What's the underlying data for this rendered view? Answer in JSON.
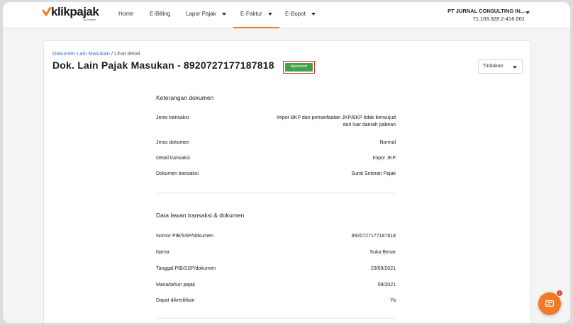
{
  "brand": {
    "name": "klikpajak",
    "tagline": "by mekari",
    "accent_color": "#f07a26"
  },
  "nav": {
    "items": [
      {
        "label": "Home",
        "dropdown": false,
        "active": false
      },
      {
        "label": "E-Billing",
        "dropdown": false,
        "active": false
      },
      {
        "label": "Lapor Pajak",
        "dropdown": true,
        "active": false
      },
      {
        "label": "E-Faktur",
        "dropdown": true,
        "active": true
      },
      {
        "label": "E-Bupot",
        "dropdown": true,
        "active": false
      }
    ]
  },
  "company": {
    "name": "PT JURNAL CONSULTING IN...",
    "npwp": "71.103.328.2-416.001"
  },
  "breadcrumb": {
    "parent": "Dokumen Lain Masukan",
    "separator": " / ",
    "current": "Lihat detail"
  },
  "page": {
    "title": "Dok. Lain Pajak Masukan - 8920727177187818",
    "status": "Approved",
    "status_color": "#3fa34d",
    "actions_label": "Tindakan"
  },
  "sections": {
    "doc_info": {
      "title": "Keterangan dokumen",
      "rows": [
        {
          "label": "Jenis transaksi",
          "value": "Impor BKP dan pemanfaatan JKP/BKP tidak berwujud dari luar daerah pabean"
        },
        {
          "label": "Jenis dokumen",
          "value": "Normal"
        },
        {
          "label": "Detail transaksi",
          "value": "Impor JKP"
        },
        {
          "label": "Dokumen transaksi",
          "value": "Surat Setoran Pajak"
        }
      ]
    },
    "counterparty": {
      "title": "Data lawan transaksi & dokumen",
      "rows": [
        {
          "label": "Nomor PIB/SSP/dokumen",
          "value": "8920727177187818"
        },
        {
          "label": "Nama",
          "value": "Suka Benar"
        },
        {
          "label": "Tanggal PIB/SSP/dokumen",
          "value": "23/09/2021"
        },
        {
          "label": "Masa/tahun pajak",
          "value": "09/2021"
        },
        {
          "label": "Dapat dikreditkan",
          "value": "Ya"
        }
      ]
    }
  },
  "chat": {
    "icon": "chat-icon",
    "badge_count": "2"
  }
}
